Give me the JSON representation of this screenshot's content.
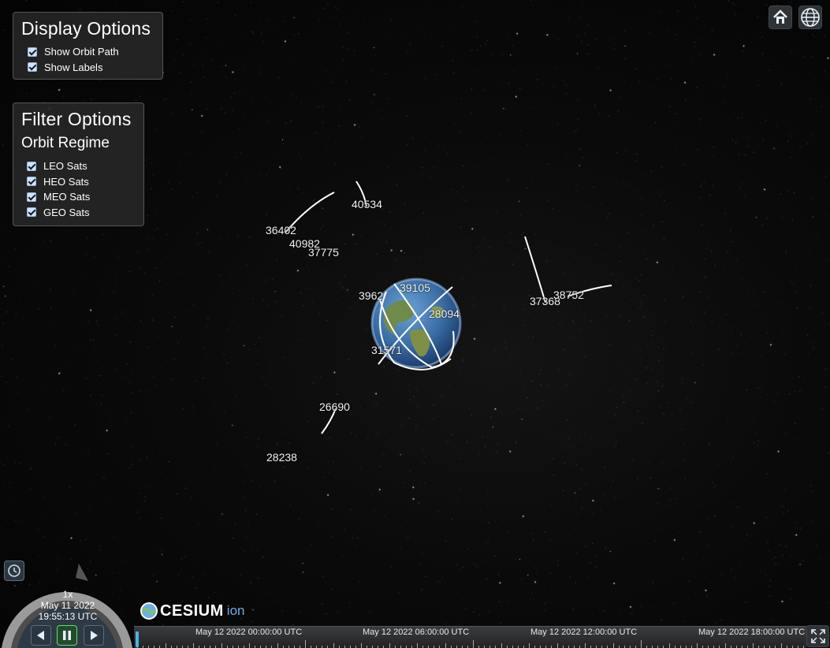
{
  "display_options": {
    "title": "Display Options",
    "options": [
      {
        "label": "Show Orbit Path",
        "checked": true
      },
      {
        "label": "Show Labels",
        "checked": true
      }
    ]
  },
  "filter_options": {
    "title": "Filter Options",
    "subtitle": "Orbit Regime",
    "options": [
      {
        "label": "LEO Sats",
        "checked": true
      },
      {
        "label": "HEO Sats",
        "checked": true
      },
      {
        "label": "MEO Sats",
        "checked": true
      },
      {
        "label": "GEO Sats",
        "checked": true
      }
    ]
  },
  "toolbar": {
    "home_icon": "home-icon",
    "globe_icon": "globe-icon"
  },
  "satellites": [
    {
      "id": "40534"
    },
    {
      "id": "36402"
    },
    {
      "id": "40982"
    },
    {
      "id": "37775"
    },
    {
      "id": "3962"
    },
    {
      "id": "39105"
    },
    {
      "id": "28094"
    },
    {
      "id": "31571"
    },
    {
      "id": "37368"
    },
    {
      "id": "38752"
    },
    {
      "id": "26690"
    },
    {
      "id": "28238"
    }
  ],
  "animation": {
    "speed": "1x",
    "date": "May 11 2022",
    "time": "19:55:13 UTC",
    "state": "paused"
  },
  "logo": {
    "text": "CESIUM",
    "suffix": "ion"
  },
  "timeline": {
    "labels": [
      "May 12 2022 00:00:00 UTC",
      "May 12 2022 06:00:00 UTC",
      "May 12 2022 12:00:00 UTC",
      "May 12 2022 18:00:00 UTC"
    ]
  },
  "colors": {
    "panel_bg": "#2a2a2a",
    "orbit": "#ffffff",
    "accent": "#48b4e8",
    "checkbox": "#cfe3ff"
  }
}
